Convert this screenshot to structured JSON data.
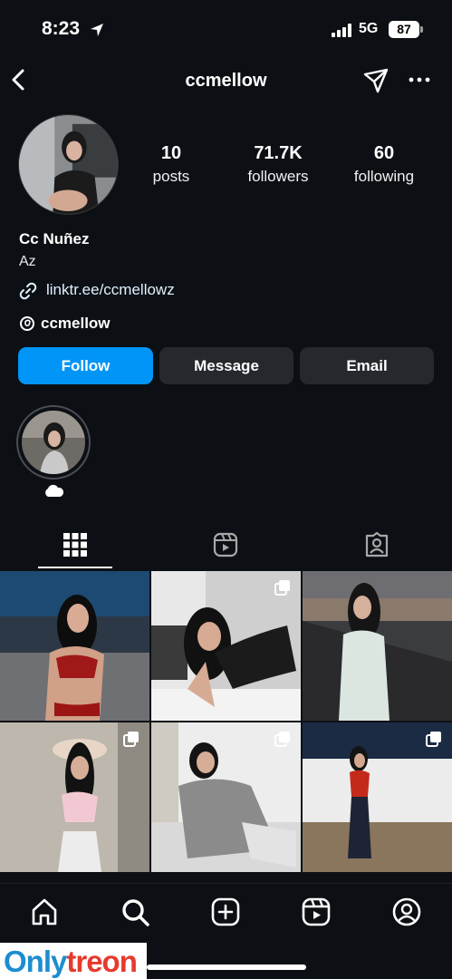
{
  "status_bar": {
    "time": "8:23",
    "network": "5G",
    "battery": "87"
  },
  "header": {
    "username": "ccmellow"
  },
  "profile": {
    "stats": [
      {
        "value": "10",
        "label": "posts"
      },
      {
        "value": "71.7K",
        "label": "followers"
      },
      {
        "value": "60",
        "label": "following"
      }
    ],
    "display_name": "Cc Nuñez",
    "bio": "Az",
    "link": "linktr.ee/ccmellowz",
    "threads_handle": "ccmellow"
  },
  "actions": {
    "follow": "Follow",
    "message": "Message",
    "email": "Email"
  },
  "highlights": [
    {
      "label_icon": "cloud-icon"
    }
  ],
  "tabs": [
    "grid-icon",
    "reels-icon",
    "tagged-icon"
  ],
  "posts": [
    {
      "multi": false
    },
    {
      "multi": true
    },
    {
      "multi": false
    },
    {
      "multi": true
    },
    {
      "multi": true
    },
    {
      "multi": true
    }
  ],
  "bottom_nav": [
    "home-icon",
    "search-icon",
    "add-icon",
    "reels-icon",
    "profile-icon"
  ],
  "watermark": {
    "part1": "Only",
    "part2": "treon"
  },
  "colors": {
    "background": "#0c1014",
    "accent": "#0095f6",
    "button": "#25292e"
  }
}
